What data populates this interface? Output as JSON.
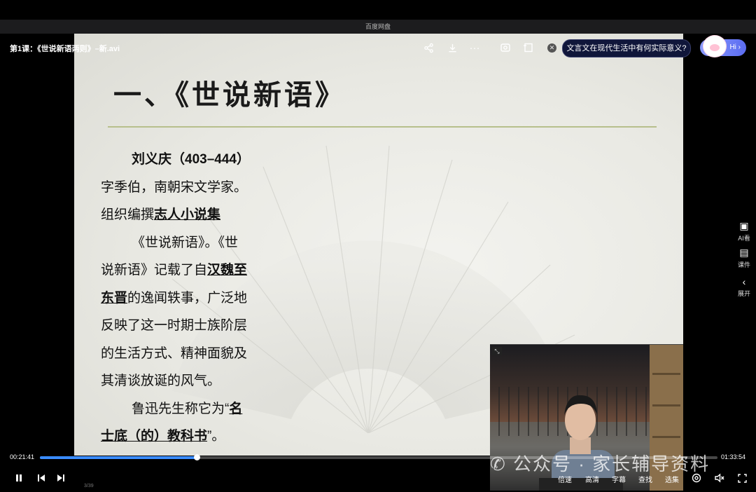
{
  "window": {
    "title": "百度网盘"
  },
  "video": {
    "filename": "第1课：《世说新语两则》–新.avi"
  },
  "ai_prompt": {
    "question": "文言文在现代生活中有何实际意义?",
    "hi_label": "Hi ›"
  },
  "side_panel": {
    "ai_label": "AI看",
    "courseware_label": "课件",
    "expand_label": "展开"
  },
  "slide": {
    "title": "一、《世说新语》",
    "lines": [
      [
        {
          "t": "刘义庆（403–444）",
          "s": "b"
        }
      ],
      [
        {
          "t": "字季伯，南朝宋文学家。",
          "s": ""
        }
      ],
      [
        {
          "t": "组织编撰",
          "s": ""
        },
        {
          "t": "志人小说集",
          "s": "u"
        }
      ],
      [
        {
          "t": "《世说新语》。《世",
          "s": ""
        }
      ],
      [
        {
          "t": "说新语》记载了自",
          "s": ""
        },
        {
          "t": "汉魏至",
          "s": "u"
        }
      ],
      [
        {
          "t": "东晋",
          "s": "u"
        },
        {
          "t": "的逸闻轶事，广泛地",
          "s": ""
        }
      ],
      [
        {
          "t": "反映了这一时期士族阶层",
          "s": ""
        }
      ],
      [
        {
          "t": "的生活方式、精神面貌及",
          "s": ""
        }
      ],
      [
        {
          "t": "其清谈放诞的风气。",
          "s": ""
        }
      ],
      [
        {
          "t": "鲁迅先生称它为“",
          "s": ""
        },
        {
          "t": "名",
          "s": "u"
        }
      ],
      [
        {
          "t": "士底（的）教科书",
          "s": "u"
        },
        {
          "t": "”。",
          "s": ""
        }
      ]
    ],
    "page": "3/39"
  },
  "watermark": "公众号 · 家长辅导资料",
  "player": {
    "current_time": "00:21:41",
    "total_time": "01:33:54",
    "progress": 0.231,
    "speed_label": "倍速",
    "quality_label": "高清",
    "subtitle_label": "字幕",
    "search_label": "查找",
    "episodes_label": "选集"
  },
  "colors": {
    "progress": "#3a8cff",
    "ai_bubble": "#10163a"
  }
}
